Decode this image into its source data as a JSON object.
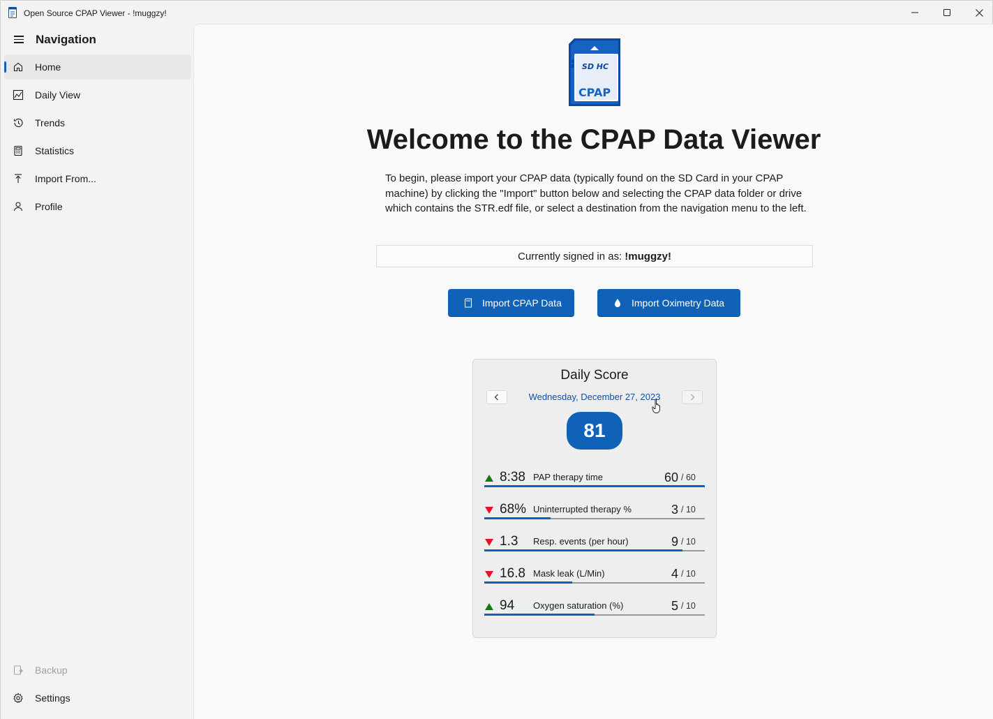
{
  "window": {
    "title": "Open Source CPAP Viewer - !muggzy!",
    "icon": "app-notebook-icon"
  },
  "sidebar": {
    "title": "Navigation",
    "items": [
      {
        "label": "Home",
        "icon": "home-icon",
        "active": true
      },
      {
        "label": "Daily View",
        "icon": "chart-icon"
      },
      {
        "label": "Trends",
        "icon": "history-icon"
      },
      {
        "label": "Statistics",
        "icon": "calculator-icon"
      },
      {
        "label": "Import From...",
        "icon": "upload-icon"
      },
      {
        "label": "Profile",
        "icon": "person-icon"
      }
    ],
    "footer": [
      {
        "label": "Backup",
        "icon": "backup-icon",
        "disabled": true
      },
      {
        "label": "Settings",
        "icon": "gear-icon"
      }
    ]
  },
  "main": {
    "logo_text": "CPAP",
    "logo_brand": "SD HC",
    "heading": "Welcome to the CPAP Data Viewer",
    "intro": "To begin, please import your CPAP data (typically found on the SD Card in your CPAP machine) by clicking the \"Import\" button below and selecting the CPAP data folder or drive which contains the STR.edf file, or select a destination from the navigation menu to the left.",
    "signed_in_prefix": "Currently signed in as:",
    "signed_in_user": "!muggzy!",
    "buttons": {
      "import_cpap": "Import CPAP Data",
      "import_oximetry": "Import Oximetry Data"
    }
  },
  "daily_score": {
    "title": "Daily Score",
    "date": "Wednesday, December 27, 2023",
    "score": "81",
    "metrics": [
      {
        "value": "8:38",
        "label": "PAP therapy time",
        "score": "60",
        "max": "/ 60",
        "trend": "up",
        "fraction": 1.0
      },
      {
        "value": "68%",
        "label": "Uninterrupted therapy %",
        "score": "3",
        "max": "/ 10",
        "trend": "down",
        "fraction": 0.3
      },
      {
        "value": "1.3",
        "label": "Resp. events (per hour)",
        "score": "9",
        "max": "/ 10",
        "trend": "down",
        "fraction": 0.9
      },
      {
        "value": "16.8",
        "label": "Mask leak (L/Min)",
        "score": "4",
        "max": "/ 10",
        "trend": "down",
        "fraction": 0.4
      },
      {
        "value": "94",
        "label": "Oxygen saturation (%)",
        "score": "5",
        "max": "/ 10",
        "trend": "up",
        "fraction": 0.5
      }
    ],
    "colors": {
      "up": "#107c10",
      "down": "#e81123",
      "accent": "#0f62b8"
    }
  }
}
